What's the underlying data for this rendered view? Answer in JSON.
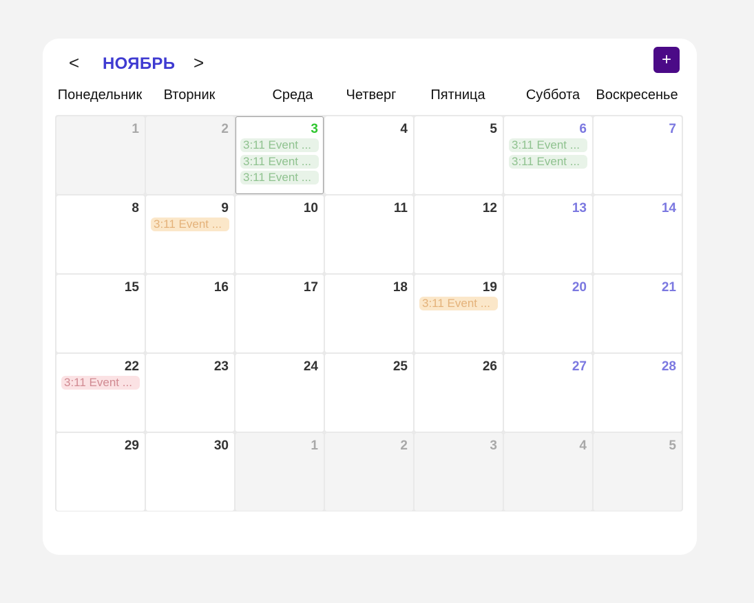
{
  "header": {
    "prev_label": "<",
    "next_label": ">",
    "month": "НОЯБРЬ",
    "add_label": "+"
  },
  "weekdays": [
    "Понедельник",
    "Вторник",
    "Среда",
    "Четверг",
    "Пятница",
    "Суббота",
    "Воскресенье"
  ],
  "colors": {
    "accent": "#3f3bd1",
    "add_button": "#4b0a87",
    "today": "#2fc62f",
    "weekend": "#7b78e0"
  },
  "days": [
    {
      "num": "1",
      "other": true
    },
    {
      "num": "2",
      "other": true
    },
    {
      "num": "3",
      "today": true,
      "events": [
        {
          "label": "3:11 Event ...",
          "color": "green"
        },
        {
          "label": "3:11 Event ...",
          "color": "green"
        },
        {
          "label": "3:11 Event ...",
          "color": "green"
        }
      ]
    },
    {
      "num": "4"
    },
    {
      "num": "5"
    },
    {
      "num": "6",
      "weekend": true,
      "events": [
        {
          "label": "3:11 Event ...",
          "color": "green"
        },
        {
          "label": "3:11 Event ...",
          "color": "green"
        }
      ]
    },
    {
      "num": "7",
      "weekend": true
    },
    {
      "num": "8"
    },
    {
      "num": "9",
      "events": [
        {
          "label": "3:11 Event ...",
          "color": "orange"
        }
      ]
    },
    {
      "num": "10"
    },
    {
      "num": "11"
    },
    {
      "num": "12"
    },
    {
      "num": "13",
      "weekend": true
    },
    {
      "num": "14",
      "weekend": true
    },
    {
      "num": "15"
    },
    {
      "num": "16"
    },
    {
      "num": "17"
    },
    {
      "num": "18"
    },
    {
      "num": "19",
      "events": [
        {
          "label": "3:11 Event ...",
          "color": "orange"
        }
      ]
    },
    {
      "num": "20",
      "weekend": true
    },
    {
      "num": "21",
      "weekend": true
    },
    {
      "num": "22",
      "events": [
        {
          "label": "3:11 Event ...",
          "color": "red"
        }
      ]
    },
    {
      "num": "23"
    },
    {
      "num": "24"
    },
    {
      "num": "25"
    },
    {
      "num": "26"
    },
    {
      "num": "27",
      "weekend": true
    },
    {
      "num": "28",
      "weekend": true
    },
    {
      "num": "29"
    },
    {
      "num": "30"
    },
    {
      "num": "1",
      "other": true
    },
    {
      "num": "2",
      "other": true
    },
    {
      "num": "3",
      "other": true
    },
    {
      "num": "4",
      "other": true
    },
    {
      "num": "5",
      "other": true
    }
  ]
}
